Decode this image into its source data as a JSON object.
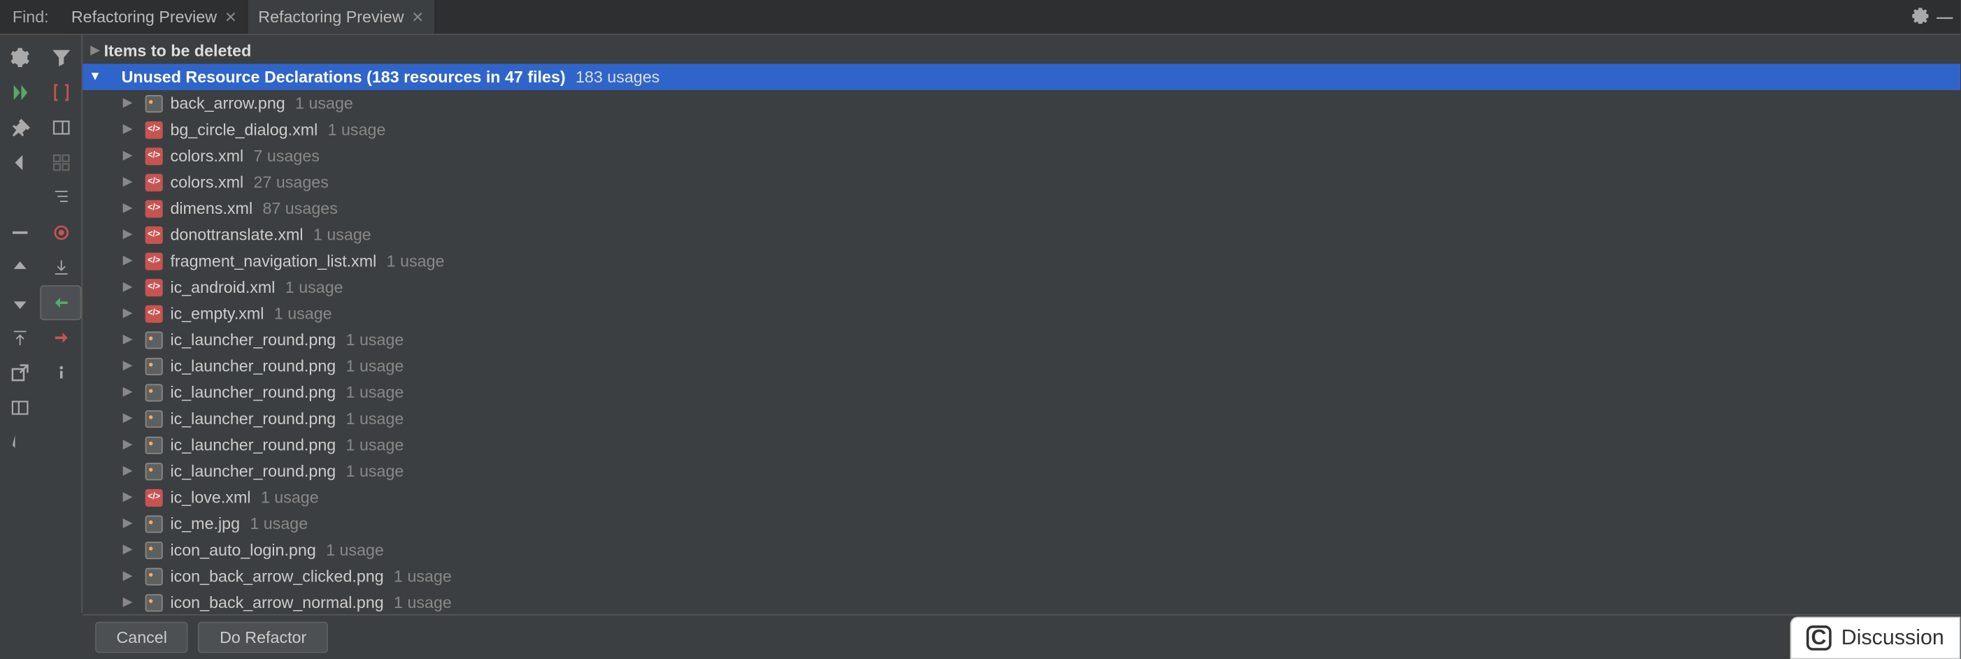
{
  "find_label": "Find:",
  "tabs": [
    {
      "title": "Refactoring Preview",
      "active": false
    },
    {
      "title": "Refactoring Preview",
      "active": true
    }
  ],
  "root_header": "Items to be deleted",
  "group_header": {
    "label": "Unused Resource Declarations (183 resources in 47 files)",
    "usage": "183 usages"
  },
  "files": [
    {
      "name": "back_arrow.png",
      "usage": "1 usage",
      "type": "png"
    },
    {
      "name": "bg_circle_dialog.xml",
      "usage": "1 usage",
      "type": "xml"
    },
    {
      "name": "colors.xml",
      "usage": "7 usages",
      "type": "xml"
    },
    {
      "name": "colors.xml",
      "usage": "27 usages",
      "type": "xml"
    },
    {
      "name": "dimens.xml",
      "usage": "87 usages",
      "type": "xml"
    },
    {
      "name": "donottranslate.xml",
      "usage": "1 usage",
      "type": "xml"
    },
    {
      "name": "fragment_navigation_list.xml",
      "usage": "1 usage",
      "type": "xml"
    },
    {
      "name": "ic_android.xml",
      "usage": "1 usage",
      "type": "xml"
    },
    {
      "name": "ic_empty.xml",
      "usage": "1 usage",
      "type": "xml"
    },
    {
      "name": "ic_launcher_round.png",
      "usage": "1 usage",
      "type": "png"
    },
    {
      "name": "ic_launcher_round.png",
      "usage": "1 usage",
      "type": "png"
    },
    {
      "name": "ic_launcher_round.png",
      "usage": "1 usage",
      "type": "png"
    },
    {
      "name": "ic_launcher_round.png",
      "usage": "1 usage",
      "type": "png"
    },
    {
      "name": "ic_launcher_round.png",
      "usage": "1 usage",
      "type": "png"
    },
    {
      "name": "ic_launcher_round.png",
      "usage": "1 usage",
      "type": "png"
    },
    {
      "name": "ic_love.xml",
      "usage": "1 usage",
      "type": "xml"
    },
    {
      "name": "ic_me.jpg",
      "usage": "1 usage",
      "type": "png"
    },
    {
      "name": "icon_auto_login.png",
      "usage": "1 usage",
      "type": "png"
    },
    {
      "name": "icon_back_arrow_clicked.png",
      "usage": "1 usage",
      "type": "png"
    },
    {
      "name": "icon_back_arrow_normal.png",
      "usage": "1 usage",
      "type": "png"
    }
  ],
  "buttons": {
    "cancel": "Cancel",
    "do_refactor": "Do Refactor"
  },
  "discussion": "Discussion"
}
